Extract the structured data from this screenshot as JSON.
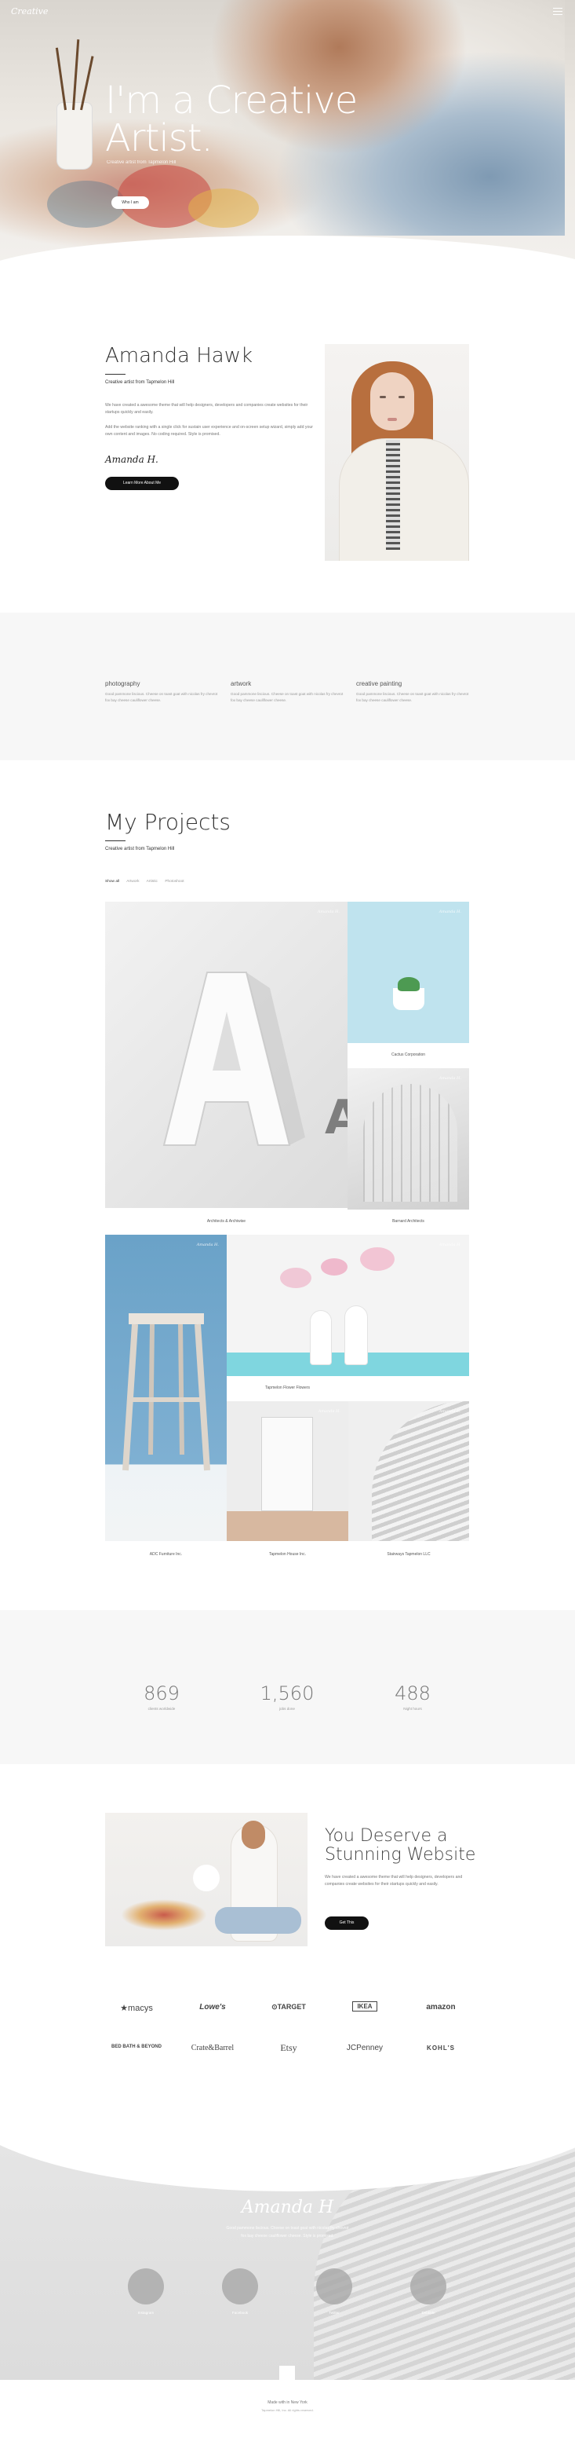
{
  "header": {
    "logo": "Creative",
    "menu_icon": "hamburger-menu-icon"
  },
  "hero": {
    "title_line1": "I'm a Creative",
    "title_line2": "Artist.",
    "subtitle": "Creative artist from Tapmelon Hill",
    "button": "Who I am"
  },
  "about": {
    "name": "Amanda Hawk",
    "tagline": "Creative artist from Tapmelon Hill",
    "paragraph1": "We have created a awesome theme that will help designers, developers and companies create websites for their startups quickly and easily.",
    "paragraph2": "Add the website ranking with a single click for sustain user experience and on-screen setup wizard, simply add your own content and images. No coding required. Style is promised.",
    "signature": "Amanda H.",
    "button": "Learn More About Me"
  },
  "services": [
    {
      "title": "photography",
      "text": "Good pammone liscious. Cheese on toast goat with nicolas fry chevrot fox bay cheese cauliflower cheese."
    },
    {
      "title": "artwork",
      "text": "Good pammone liscious. Cheese on toast goat with nicolas fry chevrot fox bay cheese cauliflower cheese."
    },
    {
      "title": "creative painting",
      "text": "Good pammone liscious. Cheese on toast goat with nicolas fry chevrot fox bay cheese cauliflower cheese."
    }
  ],
  "projects": {
    "title": "My Projects",
    "tagline": "Creative artist from Tapmelon Hill",
    "filters": [
      "Show all",
      "Artwork",
      "Artistic",
      "Photoshoot"
    ],
    "watermark": "Amanda H.",
    "captions": {
      "architecture": "Architects & Archiwise",
      "cactus": "Cactus Corporation",
      "arch_ideas": "Barnard Architects",
      "stool": "ADC Furniture Inc.",
      "flowers": "Tapmelon Flower Flowers",
      "house": "Tapmelon House Inc.",
      "stairs": "Stairways Tapmelon LLC"
    }
  },
  "counters": [
    {
      "value": "869",
      "label": "clients worldwide"
    },
    {
      "value": "1,560",
      "label": "jobs done"
    },
    {
      "value": "488",
      "label": "Night hours"
    }
  ],
  "promo": {
    "title": "You Deserve a Stunning Website",
    "text": "We have created a awesome theme that will help designers, developers and companies create websites for their startups quickly and easily.",
    "button": "Get This"
  },
  "brands": [
    "★macys",
    "Lowe's",
    "⊙TARGET",
    "IKEA",
    "amazon",
    "BED BATH & BEYOND",
    "Crate&Barrel",
    "Etsy",
    "JCPenney",
    "KOHL'S"
  ],
  "footer": {
    "signature": "Amanda H",
    "line1": "Good pammone liscious. Cheese on toast goat with nicolas fry chevrot",
    "line2": "fox bay cheese cauliflower cheese. Style is promised.",
    "social": [
      "Instagram",
      "Facebook",
      "Twitter",
      "Dribbble"
    ],
    "made_line1": "Made with in New York",
    "made_line2": "Tapmelon Hill, Inc. All rights reserved."
  }
}
